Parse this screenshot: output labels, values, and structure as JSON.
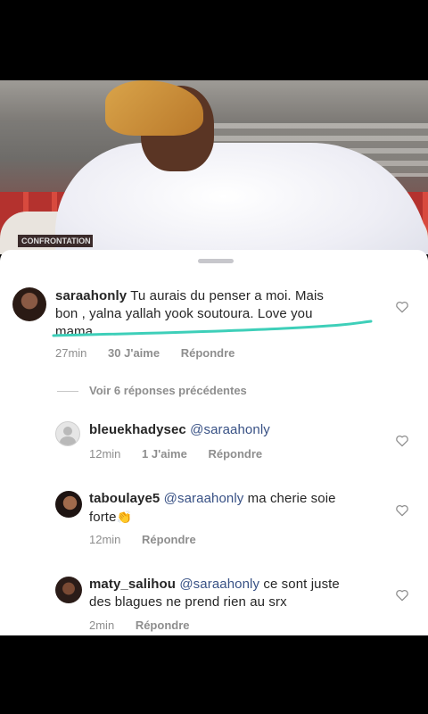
{
  "post_image": {
    "description_icon": "post-photo",
    "logo_text": "CONFRONTATION"
  },
  "comments": [
    {
      "username": "saraahonly",
      "line1": "Tu aurais du penser a moi. Mais",
      "line2": "bon , yalna yallah yook  soutoura. Love you",
      "line3": "mama.",
      "time": "27min",
      "likes": "30 J'aime",
      "reply": "Répondre"
    }
  ],
  "view_previous": "Voir 6 réponses précédentes",
  "replies": [
    {
      "username": "bleuekhadysec",
      "mention": "@saraahonly",
      "text": "",
      "time": "12min",
      "likes": "1 J'aime",
      "reply": "Répondre"
    },
    {
      "username": "taboulaye5",
      "mention": "@saraahonly",
      "text": "ma cherie soie",
      "text2": "forte",
      "emoji": "👏",
      "time": "12min",
      "reply": "Répondre"
    },
    {
      "username": "maty_salihou",
      "mention": "@saraahonly",
      "text": "ce sont juste",
      "text2": "des blagues  ne prend rien au srx",
      "time": "2min",
      "reply": "Répondre"
    }
  ],
  "colors": {
    "underline": "#3ecfb9",
    "mention": "#385185",
    "meta": "#8e8e8e"
  }
}
